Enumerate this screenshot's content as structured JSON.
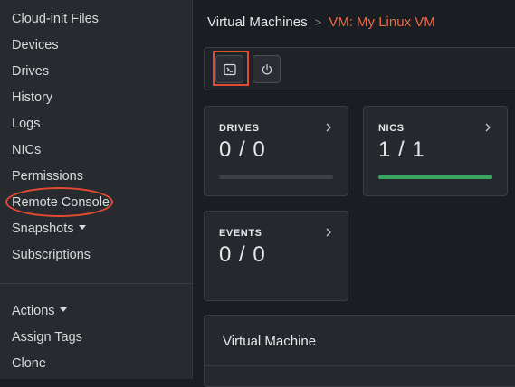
{
  "sidebar": {
    "items": [
      {
        "label": "Cloud-init Files"
      },
      {
        "label": "Devices"
      },
      {
        "label": "Drives"
      },
      {
        "label": "History"
      },
      {
        "label": "Logs"
      },
      {
        "label": "NICs"
      },
      {
        "label": "Permissions"
      },
      {
        "label": "Remote Console"
      },
      {
        "label": "Snapshots"
      },
      {
        "label": "Subscriptions"
      }
    ],
    "actions": [
      {
        "label": "Actions"
      },
      {
        "label": "Assign Tags"
      },
      {
        "label": "Clone"
      }
    ]
  },
  "breadcrumb": {
    "root": "Virtual Machines",
    "separator": ">",
    "current": "VM: My Linux VM"
  },
  "toolbar": {
    "buttons": [
      {
        "icon": "terminal-icon"
      },
      {
        "icon": "power-icon"
      }
    ]
  },
  "cards": {
    "drives": {
      "title": "DRIVES",
      "value": "0 / 0",
      "progress": 0
    },
    "nics": {
      "title": "NICS",
      "value": "1 / 1",
      "progress": 1
    },
    "events": {
      "title": "EVENTS",
      "value": "0 / 0"
    }
  },
  "panel": {
    "title": "Virtual Machine"
  },
  "colors": {
    "accent": "#ee6a45",
    "highlight": "#e34a31",
    "progress_ok": "#3aa55d",
    "sidebar_bg": "#272a2f",
    "main_bg": "#1a1d21"
  }
}
